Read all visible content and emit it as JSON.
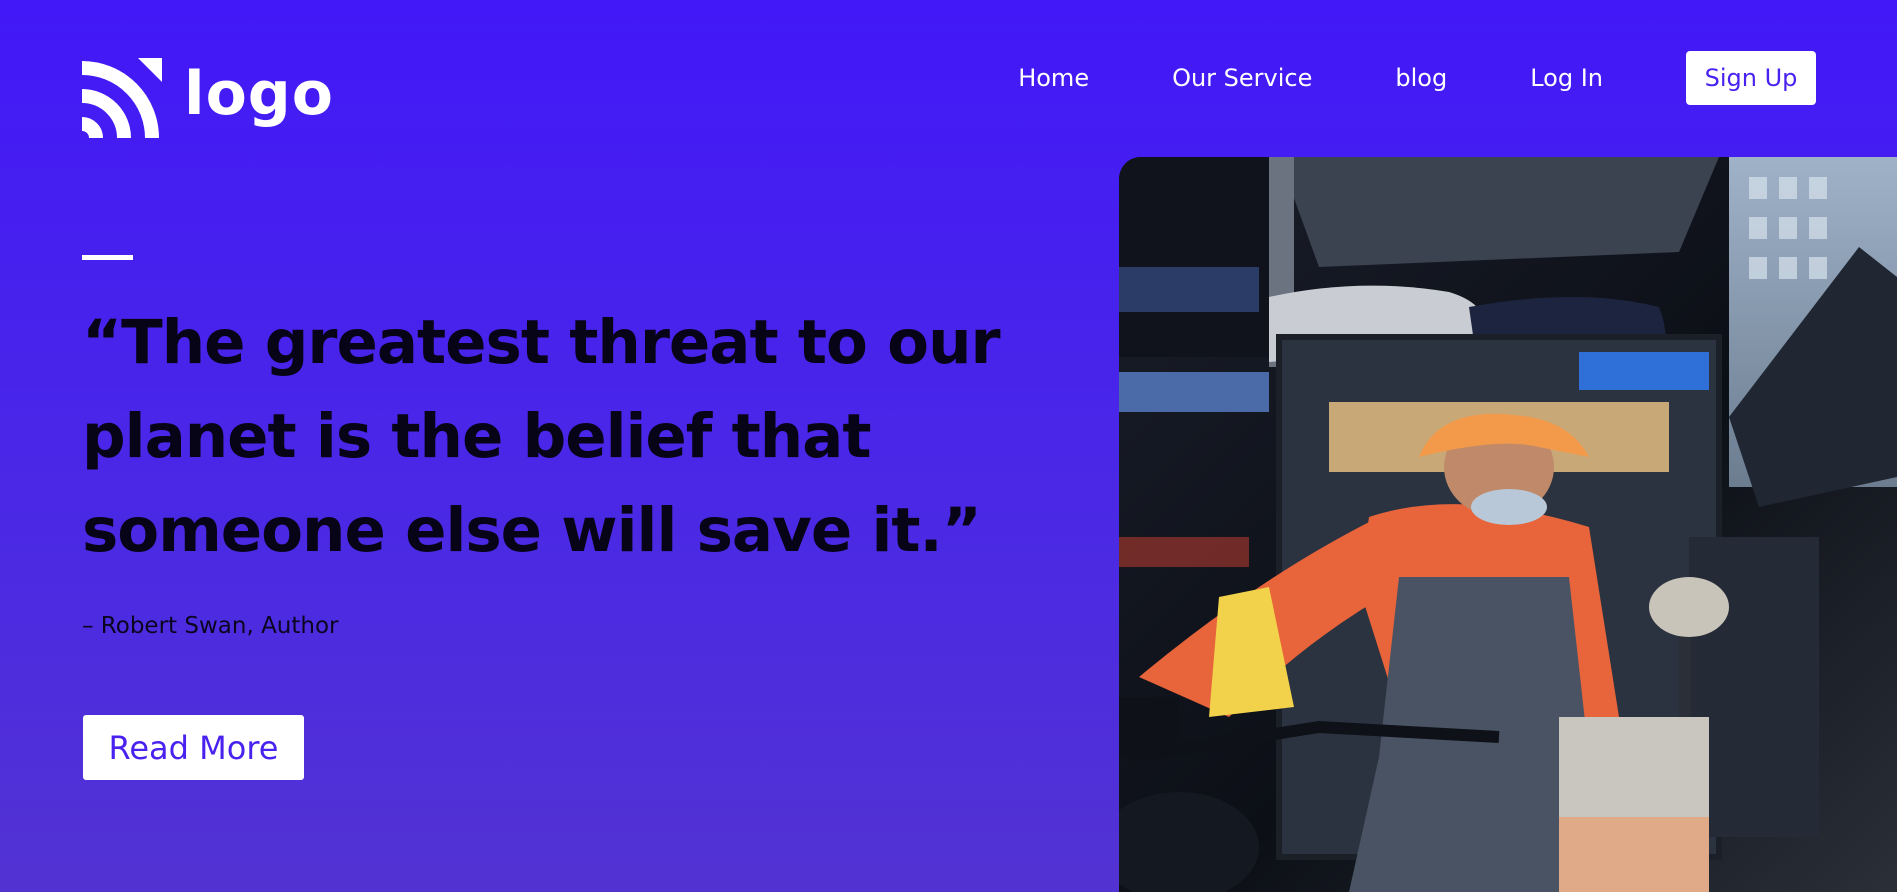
{
  "header": {
    "logo_text": "logo",
    "logo_icon": "logo-arcs-icon",
    "nav": [
      {
        "label": "Home"
      },
      {
        "label": "Our Service"
      },
      {
        "label": "blog"
      },
      {
        "label": "Log In"
      }
    ],
    "signup_label": "Sign Up"
  },
  "hero": {
    "quote_lines": [
      "“The greatest threat to our",
      "planet is the belief that",
      "someone else will save it.”"
    ],
    "author": "– Robert Swan, Author",
    "read_more_label": "Read More"
  },
  "colors": {
    "background_top": "#4218f8",
    "background_bottom": "#5233d2",
    "button_text": "#4a22f0",
    "text": "#080418"
  }
}
